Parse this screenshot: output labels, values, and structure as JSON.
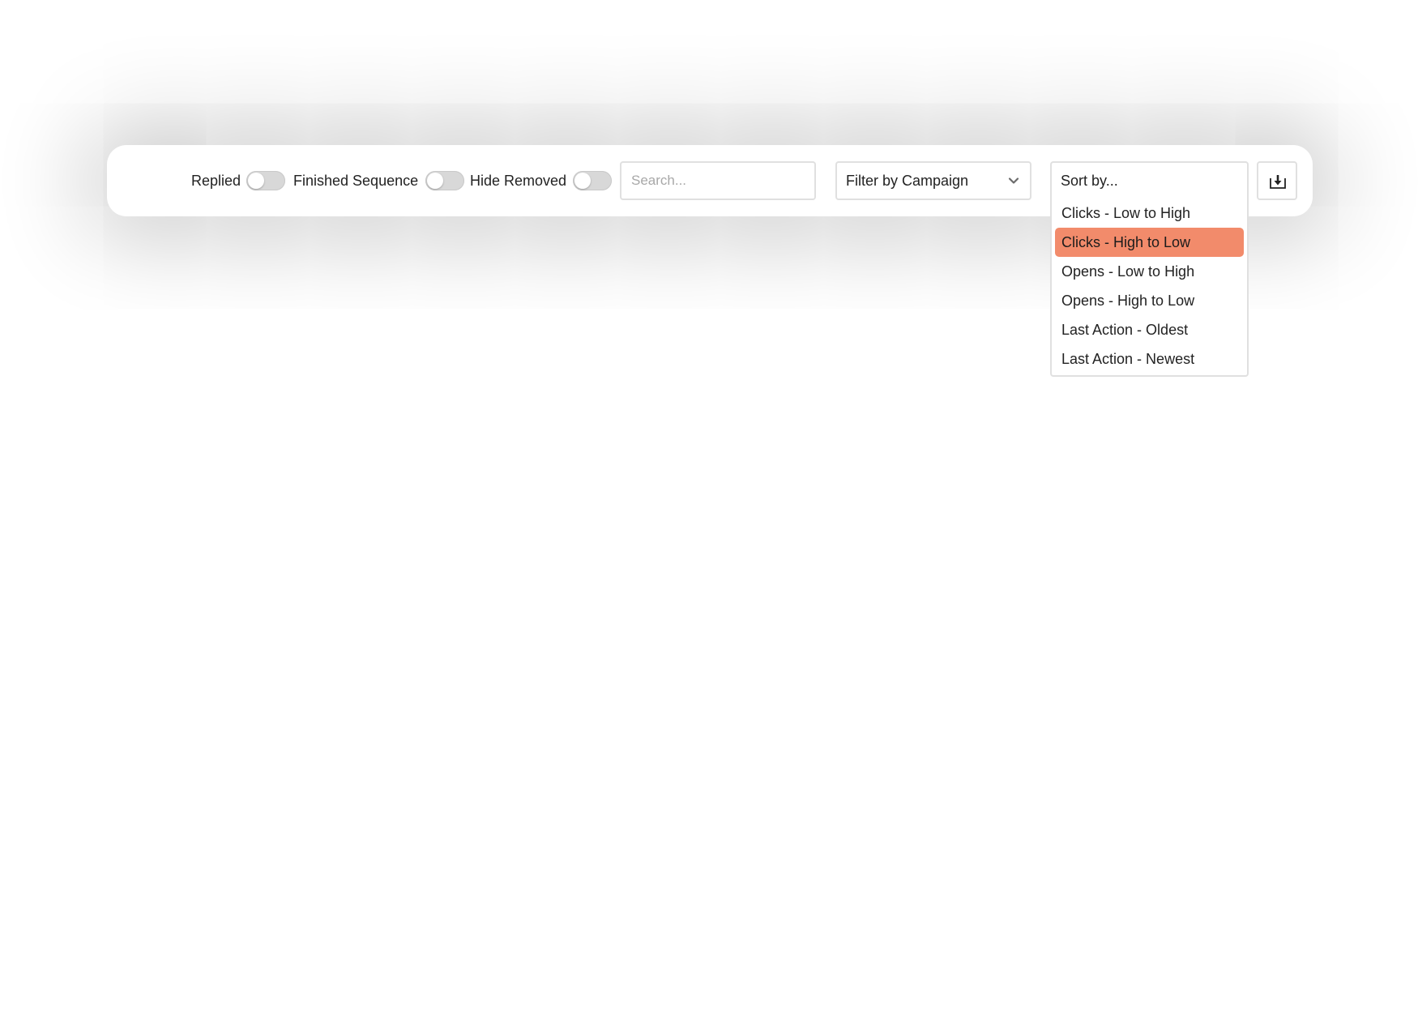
{
  "filters": {
    "replied": {
      "label": "Replied",
      "on": false
    },
    "finished_sequence": {
      "label": "Finished Sequence",
      "on": false
    },
    "hide_removed": {
      "label": "Hide Removed",
      "on": false
    }
  },
  "search": {
    "placeholder": "Search...",
    "value": ""
  },
  "campaign_filter": {
    "selected": "Filter by Campaign",
    "icon": "chevron-down-icon"
  },
  "sort": {
    "placeholder": "Sort by...",
    "options": [
      "Clicks - Low to High",
      "Clicks - High to Low",
      "Opens - Low to High",
      "Opens - High to Low",
      "Last Action - Oldest",
      "Last Action - Newest"
    ],
    "highlighted": "Clicks - High to Low",
    "highlight_color": "#f28b6b"
  },
  "download": {
    "icon": "download-icon"
  }
}
